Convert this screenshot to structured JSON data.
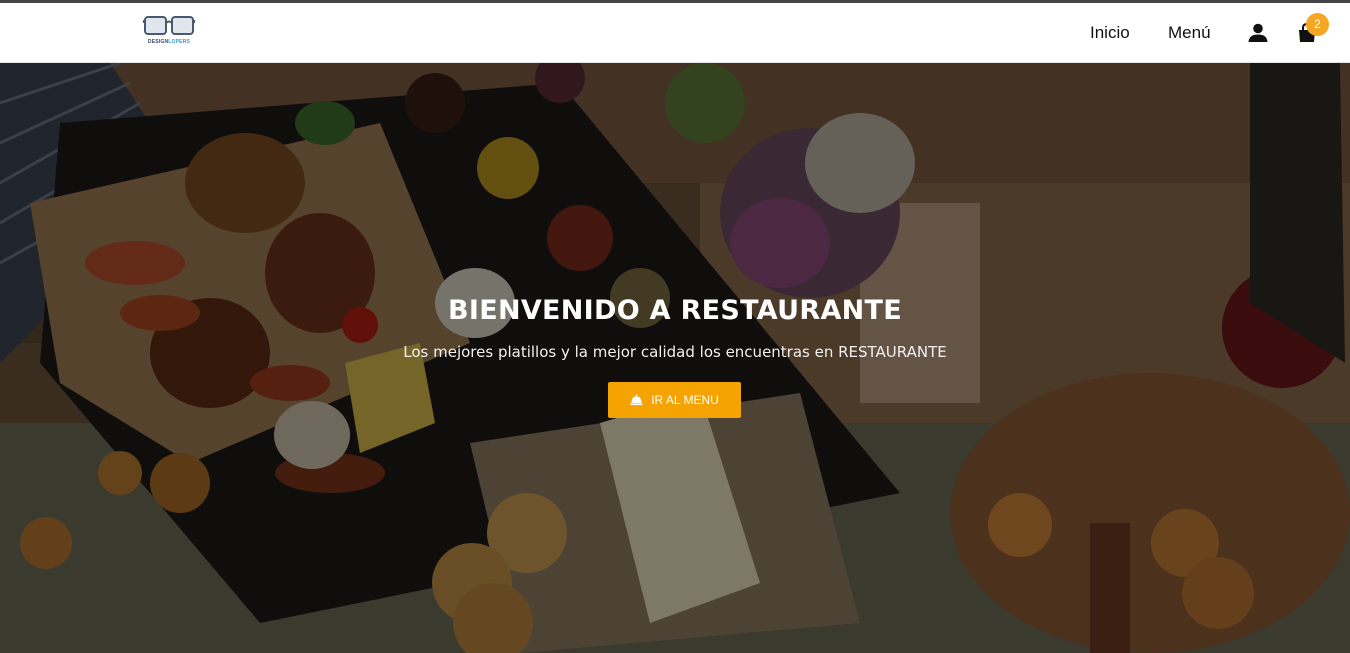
{
  "brand": {
    "logo_text_a": "DESIGN",
    "logo_text_b": "LOPERS"
  },
  "nav": {
    "home_label": "Inicio",
    "menu_label": "Menú",
    "cart_count": "2"
  },
  "hero": {
    "title": "BIENVENIDO A RESTAURANTE",
    "subtitle": "Los mejores platillos y la mejor calidad los encuentras en RESTAURANTE",
    "cta_label": "IR AL MENU"
  },
  "colors": {
    "accent": "#f5a300",
    "badge": "#f5a623",
    "nav_bg": "#ffffff",
    "text_dark": "#111111"
  },
  "icons": {
    "user": "user-icon",
    "cart": "shopping-bag-icon",
    "cta": "food-tray-icon"
  }
}
